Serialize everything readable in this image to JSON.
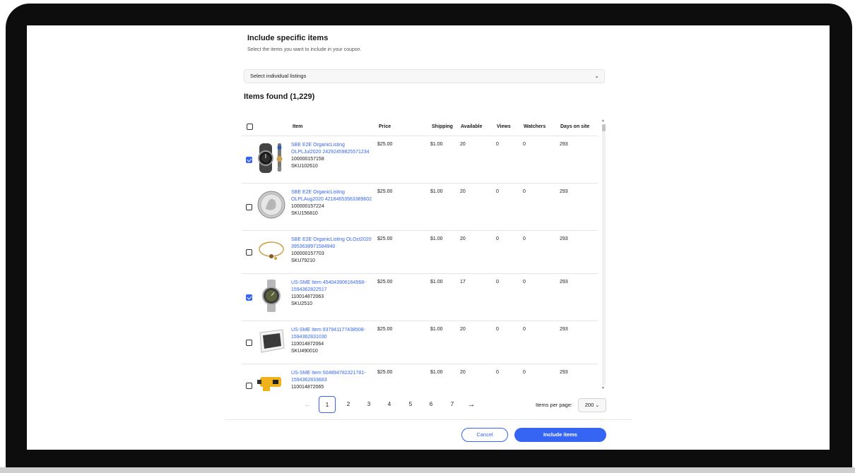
{
  "section": {
    "title": "Include specific items",
    "subtitle": "Select the items you want to include in your coupon."
  },
  "listing_select": {
    "label": "Select individual listings"
  },
  "items_found": "Items found (1,229)",
  "table": {
    "headers": {
      "item": "Item",
      "price": "Price",
      "shipping": "Shipping",
      "available": "Available",
      "views": "Views",
      "watchers": "Watchers",
      "days": "Days on site"
    },
    "rows": [
      {
        "checked": true,
        "title": "SBE E2E OrganicListing OLPLJul2020 24292459825571234",
        "id": "100000157158",
        "sku": "SKU102610",
        "price": "$25.00",
        "shipping": "$1.00",
        "available": "20",
        "views": "0",
        "watchers": "0",
        "days": "293",
        "thumb": "watch-set"
      },
      {
        "checked": false,
        "title": "SBE E2E OrganicListing OLPLAug2020 42184653563389602",
        "id": "100000157224",
        "sku": "SKU156810",
        "price": "$25.00",
        "shipping": "$1.00",
        "available": "20",
        "views": "0",
        "watchers": "0",
        "days": "293",
        "thumb": "silver-coin"
      },
      {
        "checked": false,
        "title": "SBE E2E OrganicListing OLOct2020 3953638971584940",
        "id": "100000157703",
        "sku": "SKU79210",
        "price": "$25.00",
        "shipping": "$1.00",
        "available": "20",
        "views": "0",
        "watchers": "0",
        "days": "293",
        "thumb": "bracelet"
      },
      {
        "checked": true,
        "title": "US-SME Item 454043906164568-1594362822517",
        "id": "110014872063",
        "sku": "SKU2510",
        "price": "$25.00",
        "shipping": "$1.00",
        "available": "17",
        "views": "0",
        "watchers": "0",
        "days": "293",
        "thumb": "wristwatch"
      },
      {
        "checked": false,
        "title": "US-SME Item 937941177438508-1594362831030",
        "id": "110014872064",
        "sku": "SKU490010",
        "price": "$25.00",
        "shipping": "$1.00",
        "available": "20",
        "views": "0",
        "watchers": "0",
        "days": "293",
        "thumb": "photo-print"
      },
      {
        "checked": false,
        "title": "US-SME Item 504894782321781-1594362833683",
        "id": "110014872065",
        "sku": "",
        "price": "$25.00",
        "shipping": "$1.00",
        "available": "20",
        "views": "0",
        "watchers": "0",
        "days": "293",
        "thumb": "yellow-tool"
      }
    ]
  },
  "pagination": {
    "prev_icon": "arrow-left-icon",
    "next_icon": "arrow-right-icon",
    "pages": [
      "1",
      "2",
      "3",
      "4",
      "5",
      "6",
      "7"
    ],
    "current": "1",
    "items_per_page_label": "Items per page:",
    "items_per_page_value": "200"
  },
  "actions": {
    "cancel": "Cancel",
    "include": "Include items"
  },
  "colors": {
    "accent": "#3665f3",
    "text": "#191919",
    "bezel": "#0d0d0d"
  }
}
